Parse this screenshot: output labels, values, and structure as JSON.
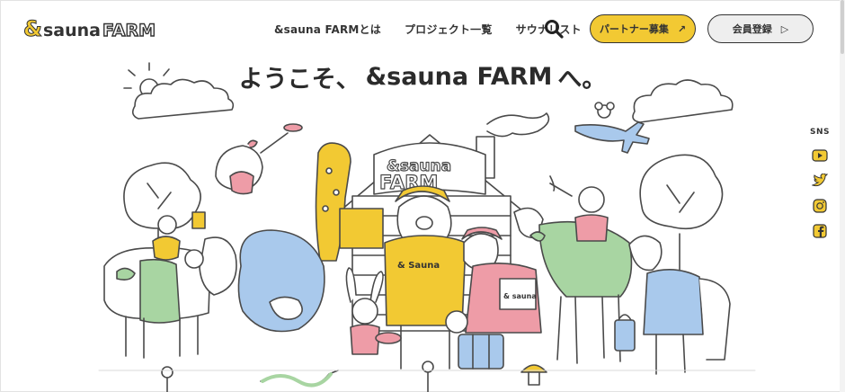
{
  "brand": {
    "ampersand": "&",
    "name_lower": "sauna",
    "name_upper": "FARM"
  },
  "nav": {
    "items": [
      {
        "label": "&sauna FARMとは"
      },
      {
        "label": "プロジェクト一覧"
      },
      {
        "label": "サウナリスト"
      }
    ]
  },
  "buttons": {
    "partner": "パートナー募集",
    "partner_arrow": "↗",
    "register": "会員登録",
    "register_arrow": "▷"
  },
  "hero": {
    "prefix": "ようこそ、",
    "brand": "&sauna FARM",
    "suffix": "へ。"
  },
  "illustration": {
    "barn_sign_top": "&sauna",
    "barn_sign_bottom": "FARM",
    "bear_shirt": "& Sauna",
    "pig_bag": "& sauna"
  },
  "sns": {
    "label": "SNS",
    "icons": [
      "youtube-icon",
      "twitter-icon",
      "instagram-icon",
      "facebook-icon"
    ]
  },
  "colors": {
    "accent": "#f2c933",
    "green": "#a8d5a2",
    "blue": "#a9c9ec",
    "pink": "#ee9ca7",
    "line": "#4a4a4a"
  }
}
